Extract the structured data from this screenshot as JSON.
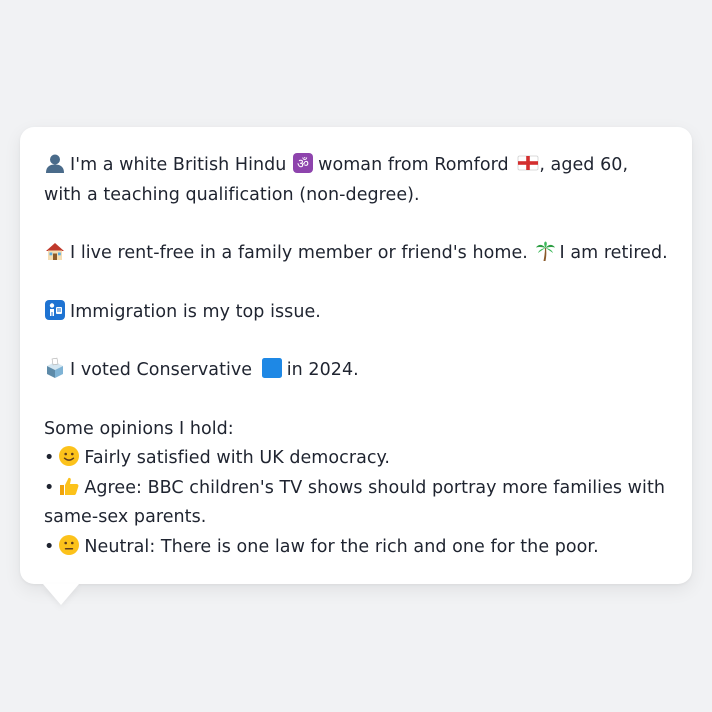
{
  "message": {
    "intro": "I'm a white British Hindu",
    "intro_mid": "woman from Romford",
    "intro_end": ", aged 60, with a teaching qualification (non-degree).",
    "housing": "I live rent-free in a family member or friend's home.",
    "employment": "I am retired.",
    "issue": "Immigration is my top issue.",
    "vote_pre": "I voted Conservative",
    "vote_post": "in 2024.",
    "opinions_heading": "Some opinions I hold:",
    "opinions": [
      {
        "icon": "slightly-smiling-face-icon",
        "text": "Fairly satisfied with UK democracy."
      },
      {
        "icon": "thumbs-up-icon",
        "text": "Agree: BBC children's TV shows should portray more families with same-sex parents."
      },
      {
        "icon": "neutral-face-icon",
        "text": "Neutral: There is one law for the rich and one for the poor."
      }
    ],
    "bullet": "•"
  },
  "icons": {
    "person": "bust-in-silhouette-icon",
    "religion": "om-symbol-icon",
    "flag": "england-flag-icon",
    "house": "house-icon",
    "retired": "palm-tree-icon",
    "immigration": "passport-control-icon",
    "ballot": "ballot-box-icon",
    "party": "blue-square-icon"
  },
  "colors": {
    "background": "#f1f2f4",
    "bubble": "#ffffff",
    "text": "#1f2430",
    "conservative_blue": "#1e88e5"
  }
}
